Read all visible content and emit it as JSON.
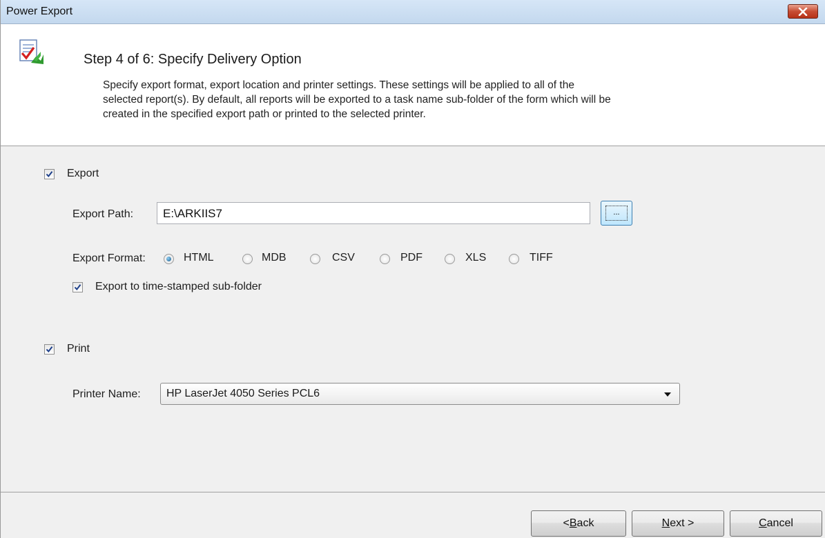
{
  "window": {
    "title": "Power Export"
  },
  "header": {
    "title": "Step 4 of 6: Specify Delivery Option",
    "description_lines": [
      "Specify export format, export location and printer settings. These settings will be applied to all of the",
      "selected report(s). By default, all reports will be exported to a task name sub-folder of the form which will be",
      "created in the specified export path or printed to the selected printer."
    ]
  },
  "export": {
    "checkbox_label": "Export",
    "checked": true,
    "path_label": "Export Path:",
    "path_value": "E:\\ARKIIS7",
    "browse_label": "...",
    "format_label": "Export Format:",
    "formats": [
      "HTML",
      "MDB",
      "CSV",
      "PDF",
      "XLS",
      "TIFF"
    ],
    "selected_format": "HTML",
    "timestamp_label": "Export to time-stamped sub-folder",
    "timestamp_checked": true
  },
  "print": {
    "checkbox_label": "Print",
    "checked": true,
    "printer_label": "Printer Name:",
    "printer_value": "HP LaserJet 4050 Series PCL6"
  },
  "buttons": {
    "back_prefix": "<",
    "back_mnemonic": "B",
    "back_rest": "ack",
    "next_mnemonic": "N",
    "next_rest": "ext >",
    "cancel_mnemonic": "C",
    "cancel_rest": "ancel"
  },
  "colors": {
    "title_bar": "#c9ddf2",
    "close_button": "#c74c33",
    "accent_check": "#1d3f8a"
  }
}
